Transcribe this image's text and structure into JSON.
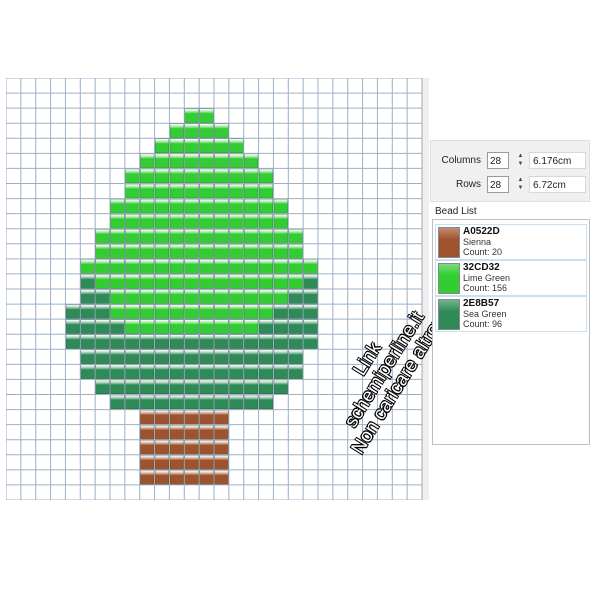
{
  "grid": {
    "columns": 28,
    "rows": 28
  },
  "size_panel": {
    "columns_label": "Columns",
    "columns_value": "28",
    "columns_size": "6.176cm",
    "rows_label": "Rows",
    "rows_value": "28",
    "rows_size": "6.72cm"
  },
  "bead_list": {
    "title": "Bead List",
    "items": [
      {
        "hex": "A0522D",
        "name": "Sienna",
        "count": "Count: 20",
        "color": "#A0522D"
      },
      {
        "hex": "32CD32",
        "name": "Lime Green",
        "count": "Count: 156",
        "color": "#32CD32"
      },
      {
        "hex": "2E8B57",
        "name": "Sea Green",
        "count": "Count: 96",
        "color": "#2E8B57"
      }
    ]
  },
  "watermark": {
    "line1": "Link",
    "line2": "schemiperline.it",
    "line3": "Non caricare altrove"
  },
  "pattern": {
    "colors": {
      "G": "#32CD32",
      "D": "#2E8B57",
      "B": "#A0522D"
    },
    "rows": [
      "............................",
      "............................",
      "............GG..............",
      "...........GGGG.............",
      "..........GGGGGG............",
      ".........GGGGGGGG...........",
      "........GGGGGGGGGG..........",
      "........GGGGGGGGGG..........",
      ".......GGGGGGGGGGGG.........",
      ".......GGGGGGGGGGGG.........",
      "......GGGGGGGGGGGGGG........",
      "......GGGGGGGGGGGGGG........",
      ".....GGGGGGGGGGGGGGGG.......",
      ".....DGGGGGGGGGGGGGGD.......",
      ".....DDGGGGGGGGGGGGDD.......",
      "....DDDGGGGGGGGGGGDDD.......",
      "....DDDDGGGGGGGGGDDDD.......",
      "....DDDDDDDDDDDDDDDDD.......",
      ".....DDDDDDDDDDDDDDD........",
      ".....DDDDDDDDDDDDDDD........",
      "......DDDDDDDDDDDDD.........",
      ".......DDDDDDDDDDD..........",
      ".........BBBBBB.............",
      ".........BBBBBB.............",
      ".........BBBBBB.............",
      ".........BBBBBB.............",
      ".........BBBBBB.............",
      "............................"
    ]
  }
}
